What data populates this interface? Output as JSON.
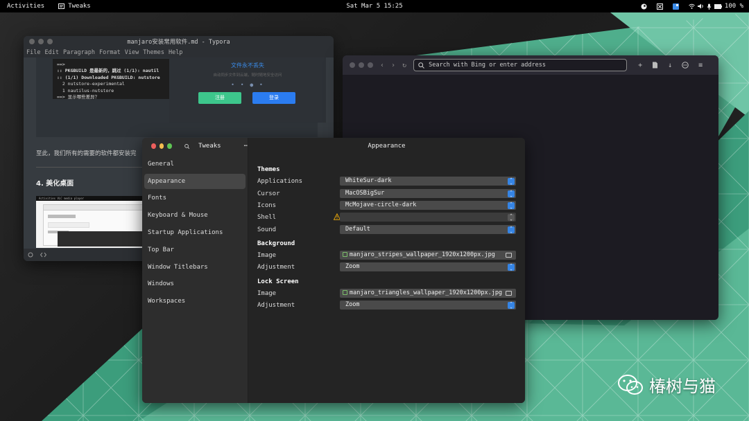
{
  "topbar": {
    "activities": "Activities",
    "app_name": "Tweaks",
    "clock": "Sat Mar 5 15:25",
    "battery": "100 %"
  },
  "typora": {
    "title": "manjaro安装常用软件.md - Typora",
    "menu": [
      "File",
      "Edit",
      "Paragraph",
      "Format",
      "View",
      "Themes",
      "Help"
    ],
    "terminal_lines": [
      "==>",
      ":: PKGBUILD 是最新的，跳过 (1/1): nautil",
      ":: (1/1) Downloaded PKGBUILD: nutstore",
      "  2 nutstore-experimental",
      "  1 nautilus-nutstore",
      "==> 显示哪些差异？"
    ],
    "dialog_title": "文件永不丢失",
    "dialog_subtitle": "自动同步文件到云端，随时随地安全访问",
    "dialog_register": "注册",
    "dialog_login": "登录",
    "paragraph": "至此，我们所有的需要的软件都安装完",
    "heading": "4. 美化桌面",
    "thumb_bar": "Activities    VLC media player"
  },
  "browser": {
    "address_placeholder": "Search with Bing or enter address"
  },
  "tweaks": {
    "sidebar_title": "Tweaks",
    "main_title": "Appearance",
    "nav": [
      "General",
      "Appearance",
      "Fonts",
      "Keyboard & Mouse",
      "Startup Applications",
      "Top Bar",
      "Window Titlebars",
      "Windows",
      "Workspaces"
    ],
    "selected_nav": "Appearance",
    "themes": {
      "section": "Themes",
      "applications_label": "Applications",
      "applications_value": "WhiteSur-dark",
      "cursor_label": "Cursor",
      "cursor_value": "MacOSBigSur",
      "icons_label": "Icons",
      "icons_value": "McMojave-circle-dark",
      "shell_label": "Shell",
      "shell_value": "",
      "sound_label": "Sound",
      "sound_value": "Default"
    },
    "background": {
      "section": "Background",
      "image_label": "Image",
      "image_value": "manjaro_stripes_wallpaper_1920x1200px.jpg",
      "adjustment_label": "Adjustment",
      "adjustment_value": "Zoom"
    },
    "lockscreen": {
      "section": "Lock Screen",
      "image_label": "Image",
      "image_value": "manjaro_triangles_wallpaper_1920x1200px.jpg",
      "adjustment_label": "Adjustment",
      "adjustment_value": "Zoom"
    }
  },
  "watermark": "椿树与猫",
  "colors": {
    "accent": "#3584e4",
    "green": "#35bf86",
    "close": "#ec5f5d",
    "minimize": "#f5bd4f",
    "maximize": "#5fc454"
  }
}
